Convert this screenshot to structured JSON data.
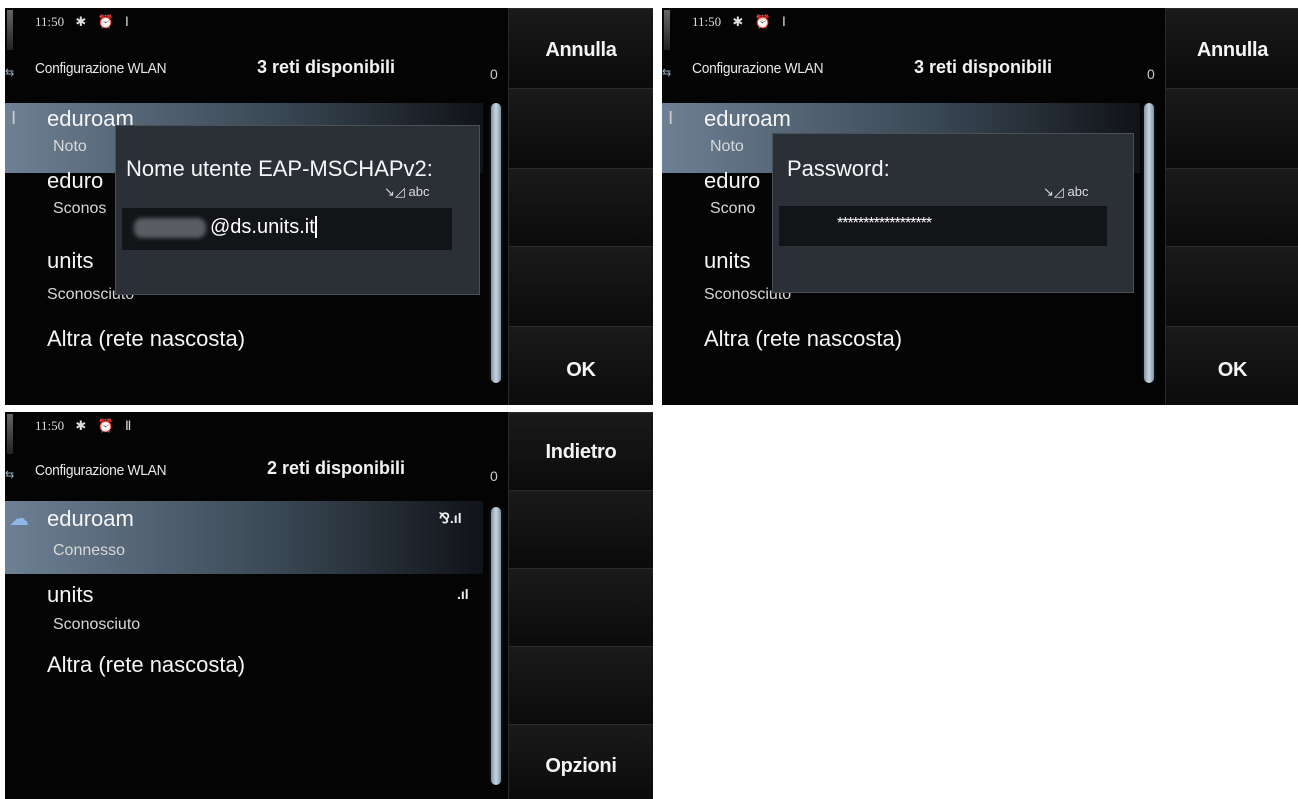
{
  "panel1": {
    "status_time": "11:50",
    "title": "Configurazione WLAN",
    "count": "3 reti disponibili",
    "zero": "0",
    "soft_top": "Annulla",
    "soft_bottom": "OK",
    "networks": [
      {
        "name": "eduroam",
        "status": "Noto"
      },
      {
        "name": "eduro",
        "status": "Sconos"
      },
      {
        "name": "units",
        "status": "Sconosciuto"
      },
      {
        "name": "Altra (rete nascosta)"
      }
    ],
    "dialog": {
      "title": "Nome utente EAP-MSCHAPv2:",
      "mode": "abc",
      "value": "@ds.units.it"
    }
  },
  "panel2": {
    "status_time": "11:50",
    "title": "Configurazione WLAN",
    "count": "3 reti disponibili",
    "zero": "0",
    "soft_top": "Annulla",
    "soft_bottom": "OK",
    "networks": [
      {
        "name": "eduroam",
        "status": "Noto"
      },
      {
        "name": "eduro",
        "status": "Scono"
      },
      {
        "name": "units",
        "status": "Sconosciuto"
      },
      {
        "name": "Altra (rete nascosta)"
      }
    ],
    "dialog": {
      "title": "Password:",
      "mode": "abc",
      "value": "******************"
    }
  },
  "panel3": {
    "status_time": "11:50",
    "title": "Configurazione WLAN",
    "count": "2 reti disponibili",
    "zero": "0",
    "soft_top": "Indietro",
    "soft_bottom": "Opzioni",
    "networks": [
      {
        "name": "eduroam",
        "status": "Connesso"
      },
      {
        "name": "units",
        "status": "Sconosciuto"
      },
      {
        "name": "Altra (rete nascosta)"
      }
    ]
  },
  "icons": {
    "bluetooth": "bluetooth-icon",
    "alarm": "alarm-icon",
    "wlan": "wlan-icon",
    "signal": "signal-bars-icon",
    "connected": "connected-icon"
  }
}
